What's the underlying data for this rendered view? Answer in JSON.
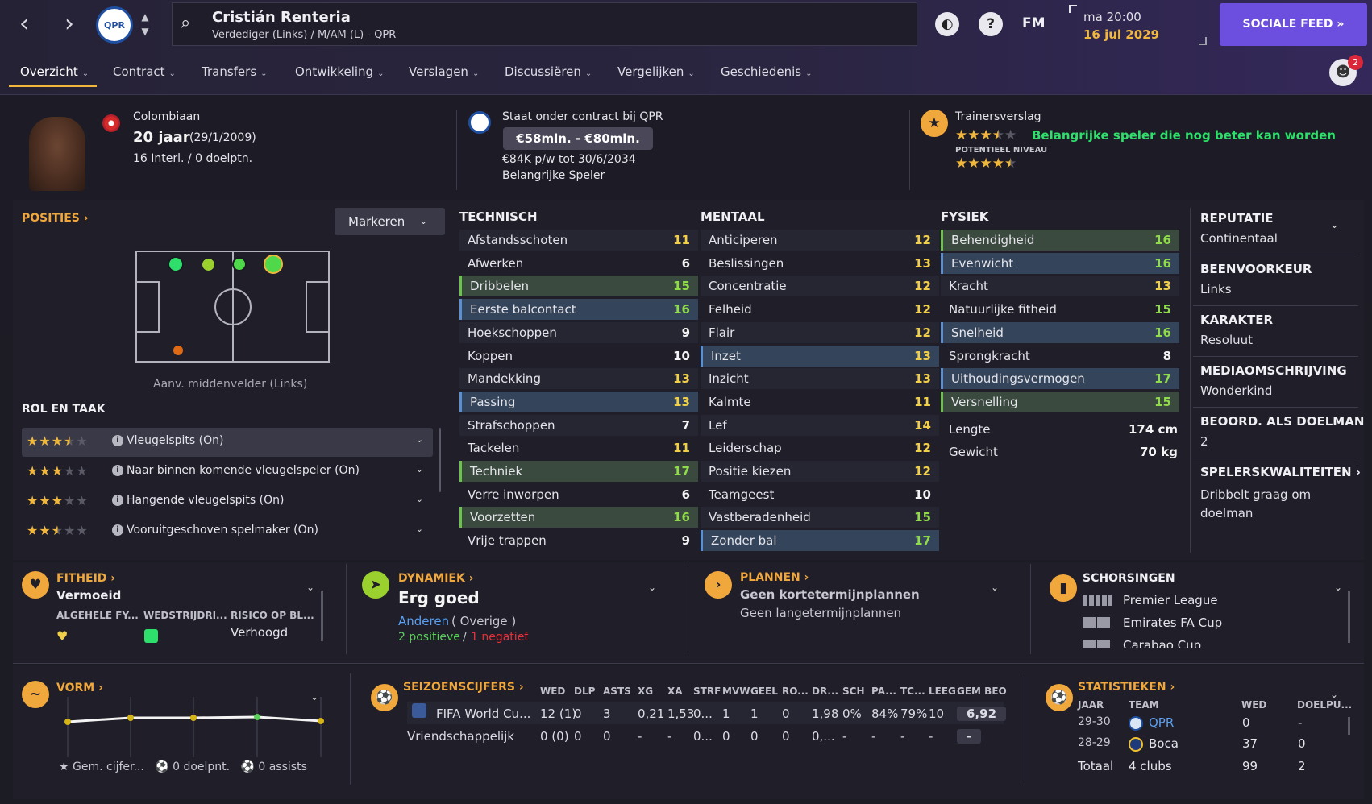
{
  "header": {
    "player_name": "Cristián Renteria",
    "player_sub": "Verdediger (Links) / M/AM (L) - QPR",
    "club_abbrev": "QPR",
    "fm_label": "FM",
    "help_label": "?",
    "time": "ma 20:00",
    "date": "16 jul 2029",
    "feed_label": "SOCIALE FEED",
    "notif_count": "2"
  },
  "tabs": [
    {
      "label": "Overzicht"
    },
    {
      "label": "Contract"
    },
    {
      "label": "Transfers"
    },
    {
      "label": "Ontwikkeling"
    },
    {
      "label": "Verslagen"
    },
    {
      "label": "Discussiëren"
    },
    {
      "label": "Vergelijken"
    },
    {
      "label": "Geschiedenis"
    }
  ],
  "bio": {
    "nationality": "Colombiaan",
    "age": "20 jaar",
    "dob": "(29/1/2009)",
    "caps": "16 Interl. / 0 doelptn."
  },
  "contract": {
    "status": "Staat onder contract bij QPR",
    "value": "€58mln. - €80mln.",
    "wage": "€84K p/w tot 30/6/2034",
    "role": "Belangrijke Speler"
  },
  "coach": {
    "title": "Trainersverslag",
    "current_stars": 3.5,
    "summary": "Belangrijke speler die nog beter kan worden",
    "potential_label": "POTENTIEEL NIVEAU",
    "potential_stars": 4.5
  },
  "positions": {
    "title": "POSITIES",
    "mark_button": "Markeren",
    "role_caption": "Aanv. middenvelder (Links)"
  },
  "roles": {
    "title": "ROL EN TAAK",
    "items": [
      {
        "stars": 3.5,
        "label": "Vleugelspits (On)"
      },
      {
        "stars": 3,
        "label": "Naar binnen komende vleugelspeler (On)"
      },
      {
        "stars": 3,
        "label": "Hangende vleugelspits (On)"
      },
      {
        "stars": 2.5,
        "label": "Vooruitgeschoven spelmaker (On)"
      }
    ]
  },
  "technical": {
    "title": "TECHNISCH",
    "rows": [
      {
        "name": "Afstandsschoten",
        "value": "11",
        "hl": ""
      },
      {
        "name": "Afwerken",
        "value": "6",
        "hl": ""
      },
      {
        "name": "Dribbelen",
        "value": "15",
        "hl": "green"
      },
      {
        "name": "Eerste balcontact",
        "value": "16",
        "hl": "blue"
      },
      {
        "name": "Hoekschoppen",
        "value": "9",
        "hl": ""
      },
      {
        "name": "Koppen",
        "value": "10",
        "hl": ""
      },
      {
        "name": "Mandekking",
        "value": "13",
        "hl": ""
      },
      {
        "name": "Passing",
        "value": "13",
        "hl": "blue"
      },
      {
        "name": "Strafschoppen",
        "value": "7",
        "hl": ""
      },
      {
        "name": "Tackelen",
        "value": "11",
        "hl": ""
      },
      {
        "name": "Techniek",
        "value": "17",
        "hl": "green"
      },
      {
        "name": "Verre inworpen",
        "value": "6",
        "hl": ""
      },
      {
        "name": "Voorzetten",
        "value": "16",
        "hl": "green"
      },
      {
        "name": "Vrije trappen",
        "value": "9",
        "hl": ""
      }
    ]
  },
  "mental": {
    "title": "MENTAAL",
    "rows": [
      {
        "name": "Anticiperen",
        "value": "12",
        "hl": ""
      },
      {
        "name": "Beslissingen",
        "value": "13",
        "hl": ""
      },
      {
        "name": "Concentratie",
        "value": "12",
        "hl": ""
      },
      {
        "name": "Felheid",
        "value": "12",
        "hl": ""
      },
      {
        "name": "Flair",
        "value": "12",
        "hl": ""
      },
      {
        "name": "Inzet",
        "value": "13",
        "hl": "blue"
      },
      {
        "name": "Inzicht",
        "value": "13",
        "hl": ""
      },
      {
        "name": "Kalmte",
        "value": "11",
        "hl": ""
      },
      {
        "name": "Lef",
        "value": "14",
        "hl": ""
      },
      {
        "name": "Leiderschap",
        "value": "12",
        "hl": ""
      },
      {
        "name": "Positie kiezen",
        "value": "12",
        "hl": ""
      },
      {
        "name": "Teamgeest",
        "value": "10",
        "hl": ""
      },
      {
        "name": "Vastberadenheid",
        "value": "15",
        "hl": ""
      },
      {
        "name": "Zonder bal",
        "value": "17",
        "hl": "blue"
      }
    ]
  },
  "physical": {
    "title": "FYSIEK",
    "rows": [
      {
        "name": "Behendigheid",
        "value": "16",
        "hl": "green"
      },
      {
        "name": "Evenwicht",
        "value": "16",
        "hl": "blue"
      },
      {
        "name": "Kracht",
        "value": "13",
        "hl": ""
      },
      {
        "name": "Natuurlijke fitheid",
        "value": "15",
        "hl": ""
      },
      {
        "name": "Snelheid",
        "value": "16",
        "hl": "blue"
      },
      {
        "name": "Sprongkracht",
        "value": "8",
        "hl": ""
      },
      {
        "name": "Uithoudingsvermogen",
        "value": "17",
        "hl": "blue"
      },
      {
        "name": "Versnelling",
        "value": "15",
        "hl": "green"
      }
    ],
    "height_label": "Lengte",
    "height": "174 cm",
    "weight_label": "Gewicht",
    "weight": "70 kg"
  },
  "profile": {
    "reputation_k": "REPUTATIE",
    "reputation_v": "Continentaal",
    "foot_k": "BEENVOORKEUR",
    "foot_v": "Links",
    "character_k": "KARAKTER",
    "character_v": "Resoluut",
    "media_k": "MEDIAOMSCHRIJVING",
    "media_v": "Wonderkind",
    "gk_k": "BEOORD. ALS DOELMAN",
    "gk_v": "2",
    "qualities_k": "SPELERSKWALITEITEN",
    "qualities_v1": "Dribbelt graag om",
    "qualities_v2": "doelman"
  },
  "fitness": {
    "title": "FITHEID",
    "status": "Vermoeid",
    "col1": "ALGEHELE FY...",
    "col2": "WEDSTRIJDRI...",
    "col3": "RISICO OP BL...",
    "risk": "Verhoogd"
  },
  "dynamics": {
    "title": "DYNAMIEK",
    "status": "Erg goed",
    "group": "Anderen",
    "group_sub": "( Overige )",
    "positive": "2 positieve",
    "sep": "/",
    "negative": "1 negatief"
  },
  "plans": {
    "title": "PLANNEN",
    "short": "Geen kortetermijnplannen",
    "long": "Geen langetermijnplannen"
  },
  "suspensions": {
    "title": "SCHORSINGEN",
    "items": [
      "Premier League",
      "Emirates FA Cup",
      "Carabao Cup"
    ]
  },
  "form": {
    "title": "VORM",
    "avg": "Gem. cijfer...",
    "goals": "0 doelpnt.",
    "assists": "0 assists"
  },
  "season": {
    "title": "SEIZOENSCIJFERS",
    "headers": [
      "WED",
      "DLP",
      "ASTS",
      "XG",
      "XA",
      "STRF",
      "MVW",
      "GEEL",
      "RO...",
      "DR...",
      "SCH",
      "PA...",
      "TC...",
      "LEEG",
      "GEM BEO"
    ],
    "rows": [
      {
        "comp": "FIFA World Cu...",
        "cells": [
          "12 (1)",
          "0",
          "3",
          "0,21",
          "1,53",
          "0...",
          "1",
          "1",
          "0",
          "1,98",
          "0%",
          "84%",
          "79%",
          "10",
          "6,92"
        ]
      },
      {
        "comp": "Vriendschappelijk",
        "cells": [
          "0 (0)",
          "0",
          "0",
          "-",
          "-",
          "0...",
          "0",
          "0",
          "0",
          "0,...",
          "-",
          "-",
          "-",
          "-",
          "-"
        ]
      }
    ]
  },
  "stats": {
    "title": "STATISTIEKEN",
    "h_year": "JAAR",
    "h_team": "TEAM",
    "h_apps": "WED",
    "h_goals": "DOELPU...",
    "rows": [
      {
        "year": "29-30",
        "team": "QPR",
        "apps": "0",
        "goals": "-"
      },
      {
        "year": "28-29",
        "team": "Boca",
        "apps": "37",
        "goals": "0"
      }
    ],
    "total_label": "Totaal",
    "total_team": "4 clubs",
    "total_apps": "99",
    "total_goals": "2"
  }
}
